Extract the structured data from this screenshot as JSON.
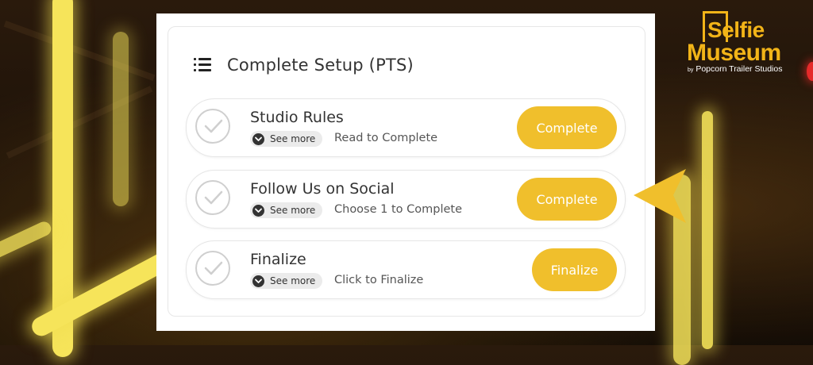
{
  "colors": {
    "accent": "#f0bf2c",
    "logo": "#f2b418",
    "panel": "#ffffff"
  },
  "header": {
    "title": "Complete Setup (PTS)",
    "icon": "list-icon"
  },
  "tasks": [
    {
      "title": "Studio Rules",
      "see_more": "See more",
      "description": "Read to Complete",
      "button": "Complete"
    },
    {
      "title": "Follow Us on Social",
      "see_more": "See more",
      "description": "Choose 1 to Complete",
      "button": "Complete"
    },
    {
      "title": "Finalize",
      "see_more": "See more",
      "description": "Click to Finalize",
      "button": "Finalize"
    }
  ],
  "logo": {
    "line1": "Selfie",
    "line2": "Museum",
    "by": "by",
    "studio": "Popcorn Trailer Studios"
  }
}
